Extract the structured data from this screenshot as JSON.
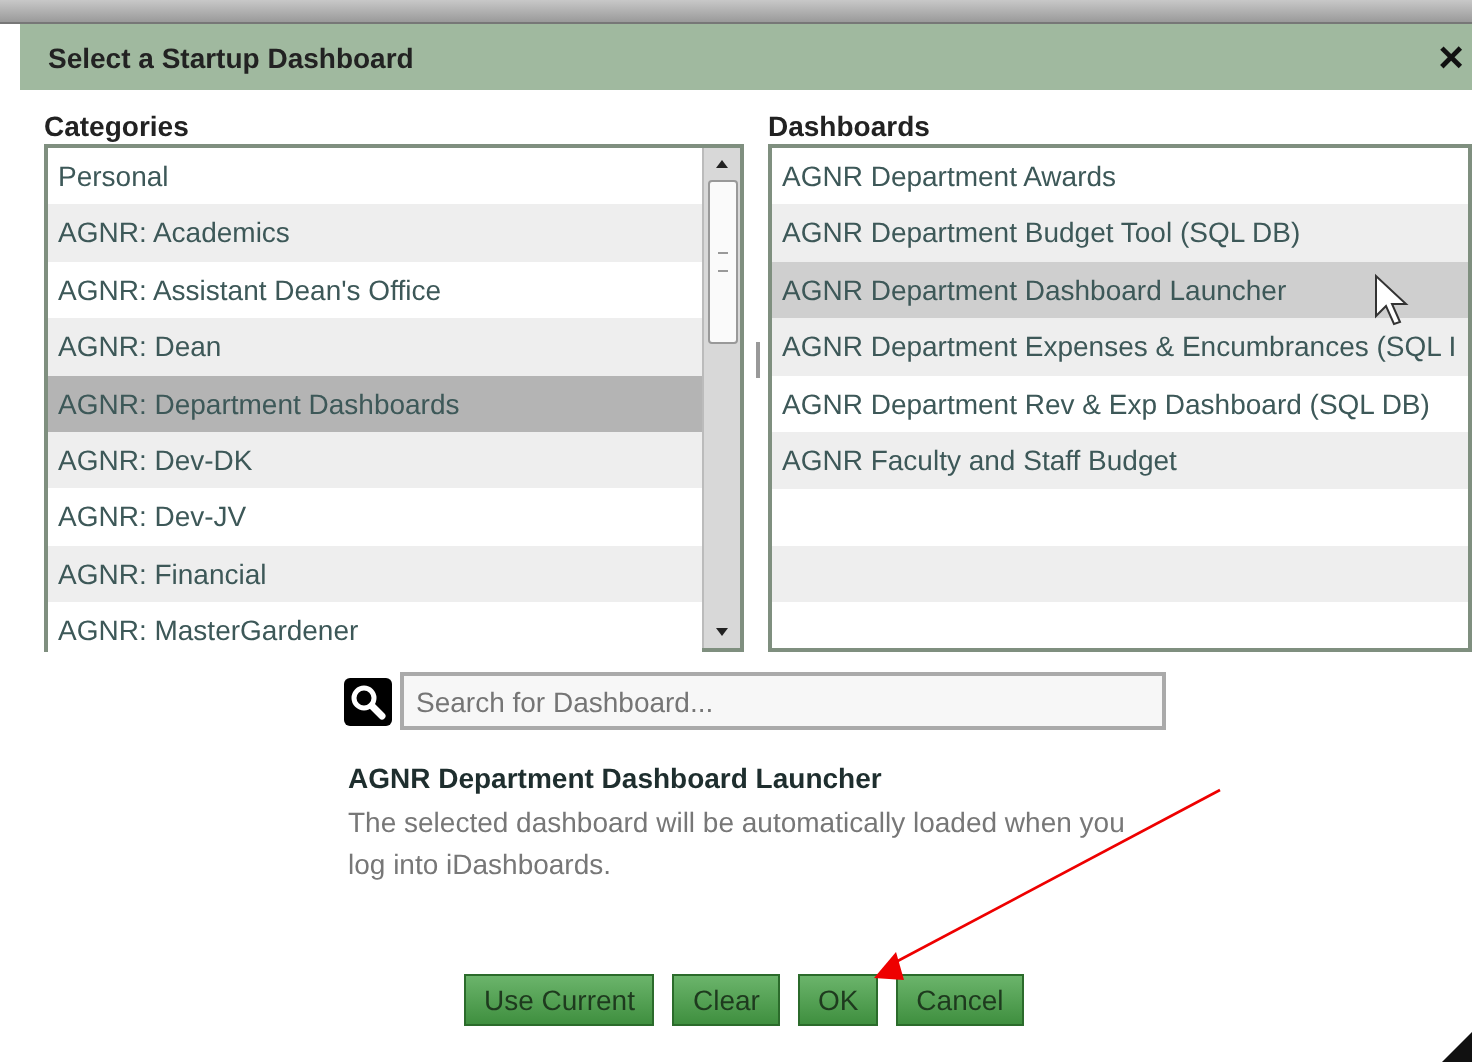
{
  "window": {
    "title": "Select a Startup Dashboard",
    "close": "×"
  },
  "categories": {
    "label": "Categories",
    "items": [
      {
        "label": "Personal",
        "selected": false
      },
      {
        "label": "AGNR: Academics",
        "selected": false
      },
      {
        "label": "AGNR: Assistant Dean's Office",
        "selected": false
      },
      {
        "label": "AGNR: Dean",
        "selected": false
      },
      {
        "label": "AGNR: Department Dashboards",
        "selected": true
      },
      {
        "label": "AGNR: Dev-DK",
        "selected": false
      },
      {
        "label": "AGNR: Dev-JV",
        "selected": false
      },
      {
        "label": "AGNR: Financial",
        "selected": false
      },
      {
        "label": "AGNR: MasterGardener",
        "selected": false
      }
    ]
  },
  "dashboards": {
    "label": "Dashboards",
    "items": [
      {
        "label": "AGNR Department Awards",
        "selected": false
      },
      {
        "label": "AGNR Department Budget Tool (SQL DB)",
        "selected": false
      },
      {
        "label": "AGNR Department Dashboard Launcher",
        "selected": true
      },
      {
        "label": "AGNR Department Expenses & Encumbrances (SQL I",
        "selected": false
      },
      {
        "label": "AGNR Department Rev & Exp Dashboard (SQL DB)",
        "selected": false
      },
      {
        "label": "AGNR Faculty and Staff Budget",
        "selected": false
      }
    ]
  },
  "search": {
    "placeholder": "Search for Dashboard..."
  },
  "selection": {
    "title": "AGNR Department Dashboard Launcher",
    "description": "The selected dashboard will be automatically loaded when you log into iDashboards."
  },
  "buttons": [
    "Use Current",
    "Clear",
    "OK",
    "Cancel"
  ]
}
